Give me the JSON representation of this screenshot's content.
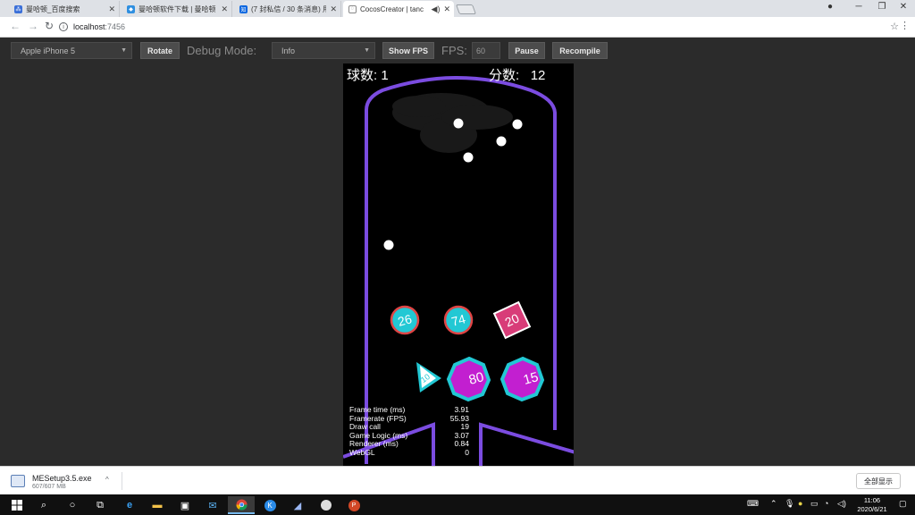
{
  "browser": {
    "tabs": [
      {
        "title": "曼哈顿_百度搜索",
        "fav": "baidu"
      },
      {
        "title": "曼哈顿软件下载 | 曼哈顿",
        "fav": "app"
      },
      {
        "title": "(7 封私信 / 30 条消息) 用…",
        "fav": "zhihu"
      },
      {
        "title": "CocosCreator | tanc",
        "fav": "cocos"
      }
    ],
    "address": {
      "host": "localhost",
      "port": ":7456"
    }
  },
  "cocos_toolbar": {
    "device": "Apple iPhone 5",
    "rotate": "Rotate",
    "debug_label": "Debug Mode:",
    "debug_value": "Info",
    "show_fps": "Show FPS",
    "fps_label": "FPS:",
    "fps_value": "60",
    "pause": "Pause",
    "recompile": "Recompile"
  },
  "game": {
    "balls_label": "球数:",
    "balls_value": "1",
    "score_label": "分数:",
    "score_value": "12",
    "colors": {
      "wall": "#7b4ce0",
      "teal": "#22c8d4",
      "magenta": "#c21fd0",
      "pink": "#d83c78",
      "ring_red": "#e04444"
    },
    "blocks": [
      {
        "shape": "circle",
        "value": "26"
      },
      {
        "shape": "circle",
        "value": "74"
      },
      {
        "shape": "square",
        "value": "20"
      },
      {
        "shape": "triangle",
        "value": "10"
      },
      {
        "shape": "octagon",
        "value": "80"
      },
      {
        "shape": "octagon",
        "value": "15"
      }
    ],
    "stats": [
      {
        "label": "Frame time (ms)",
        "value": "3.91"
      },
      {
        "label": "Framerate (FPS)",
        "value": "55.93"
      },
      {
        "label": "Draw call",
        "value": "19"
      },
      {
        "label": "Game Logic (ms)",
        "value": "3.07"
      },
      {
        "label": "Renderer (ms)",
        "value": "0.84"
      },
      {
        "label": "WebGL",
        "value": "0"
      }
    ]
  },
  "downloads": {
    "file": "MESetup3.5.exe",
    "size": "607/607 MB",
    "show_all": "全部显示"
  },
  "taskbar": {
    "time": "11:06",
    "date": "2020/6/21"
  }
}
